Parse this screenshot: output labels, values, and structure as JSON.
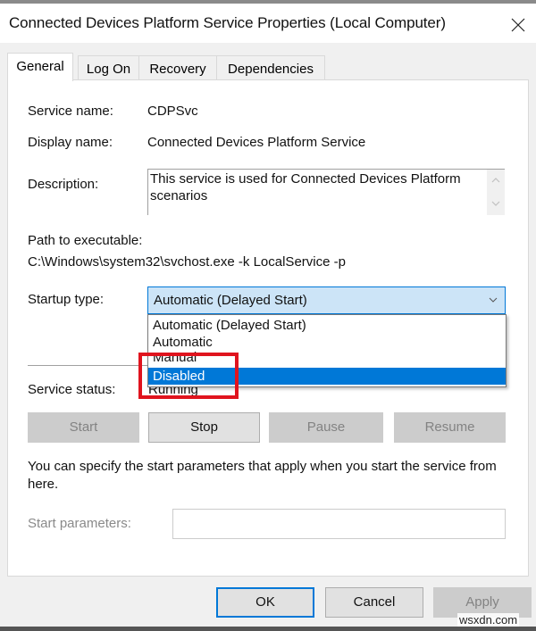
{
  "window": {
    "title": "Connected Devices Platform Service Properties (Local Computer)",
    "close_icon": "close-icon"
  },
  "tabs": [
    {
      "label": "General",
      "active": true
    },
    {
      "label": "Log On",
      "active": false
    },
    {
      "label": "Recovery",
      "active": false
    },
    {
      "label": "Dependencies",
      "active": false
    }
  ],
  "general": {
    "service_name_label": "Service name:",
    "service_name": "CDPSvc",
    "display_name_label": "Display name:",
    "display_name": "Connected Devices Platform Service",
    "description_label": "Description:",
    "description": "This service is used for Connected Devices Platform scenarios",
    "path_label": "Path to executable:",
    "path": "C:\\Windows\\system32\\svchost.exe -k LocalService -p",
    "startup_type_label": "Startup type:",
    "startup_type_value": "Automatic (Delayed Start)",
    "startup_options": [
      {
        "label": "Automatic (Delayed Start)",
        "selected": false
      },
      {
        "label": "Automatic",
        "selected": false
      },
      {
        "label": "Manual",
        "selected": false
      },
      {
        "label": "Disabled",
        "selected": true
      }
    ],
    "service_status_label": "Service status:",
    "service_status": "Running",
    "buttons": {
      "start": {
        "label": "Start",
        "enabled": false
      },
      "stop": {
        "label": "Stop",
        "enabled": true
      },
      "pause": {
        "label": "Pause",
        "enabled": false
      },
      "resume": {
        "label": "Resume",
        "enabled": false
      }
    },
    "start_params_info": "You can specify the start parameters that apply when you start the service from here.",
    "start_params_label": "Start parameters:",
    "start_params_value": ""
  },
  "footer": {
    "ok": "OK",
    "cancel": "Cancel",
    "apply": "Apply"
  },
  "annotation": {
    "highlight_color": "#e0141e",
    "highlighted_option": "Disabled"
  },
  "colors": {
    "accent": "#0078d7",
    "combo_bg": "#cce4f7",
    "disabled_btn": "#cccccc"
  },
  "watermark": "wsxdn.com"
}
